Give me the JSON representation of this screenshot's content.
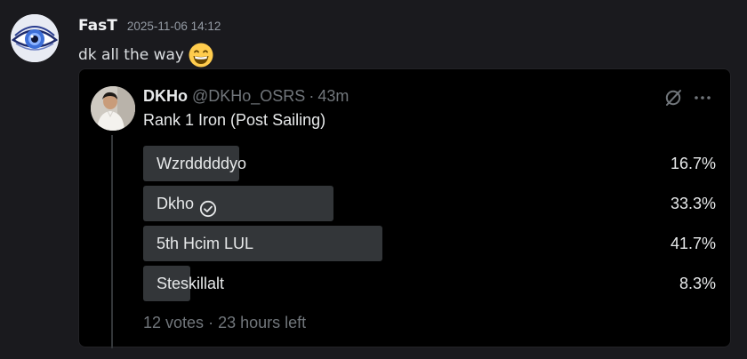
{
  "message": {
    "author": "FasT",
    "timestamp": "2025-11-06 14:12",
    "text": "dk all the way",
    "emoji": "grinning-face-emoji"
  },
  "embed": {
    "display_name": "DKHo",
    "handle": "@DKHo_OSRS",
    "separator": "·",
    "time_ago": "43m",
    "body": "Rank 1 Iron (Post Sailing)",
    "poll": {
      "options": [
        {
          "label": "Wzrdddddyo",
          "percent": "16.7%",
          "fraction": 0.167,
          "verified": false
        },
        {
          "label": "Dkho",
          "percent": "33.3%",
          "fraction": 0.333,
          "verified": true
        },
        {
          "label": "5th Hcim LUL",
          "percent": "41.7%",
          "fraction": 0.417,
          "verified": false
        },
        {
          "label": "Steskillalt",
          "percent": "8.3%",
          "fraction": 0.083,
          "verified": false
        }
      ],
      "votes": "12 votes",
      "separator": "·",
      "time_left": "23 hours left"
    },
    "icons": [
      "grok-icon",
      "more-icon",
      "check-circle-icon"
    ]
  },
  "colors": {
    "background": "#1a1a1e",
    "embed_bg": "#000000",
    "bar": "#333639",
    "muted": "#71767b",
    "text": "#e7e9ea"
  }
}
